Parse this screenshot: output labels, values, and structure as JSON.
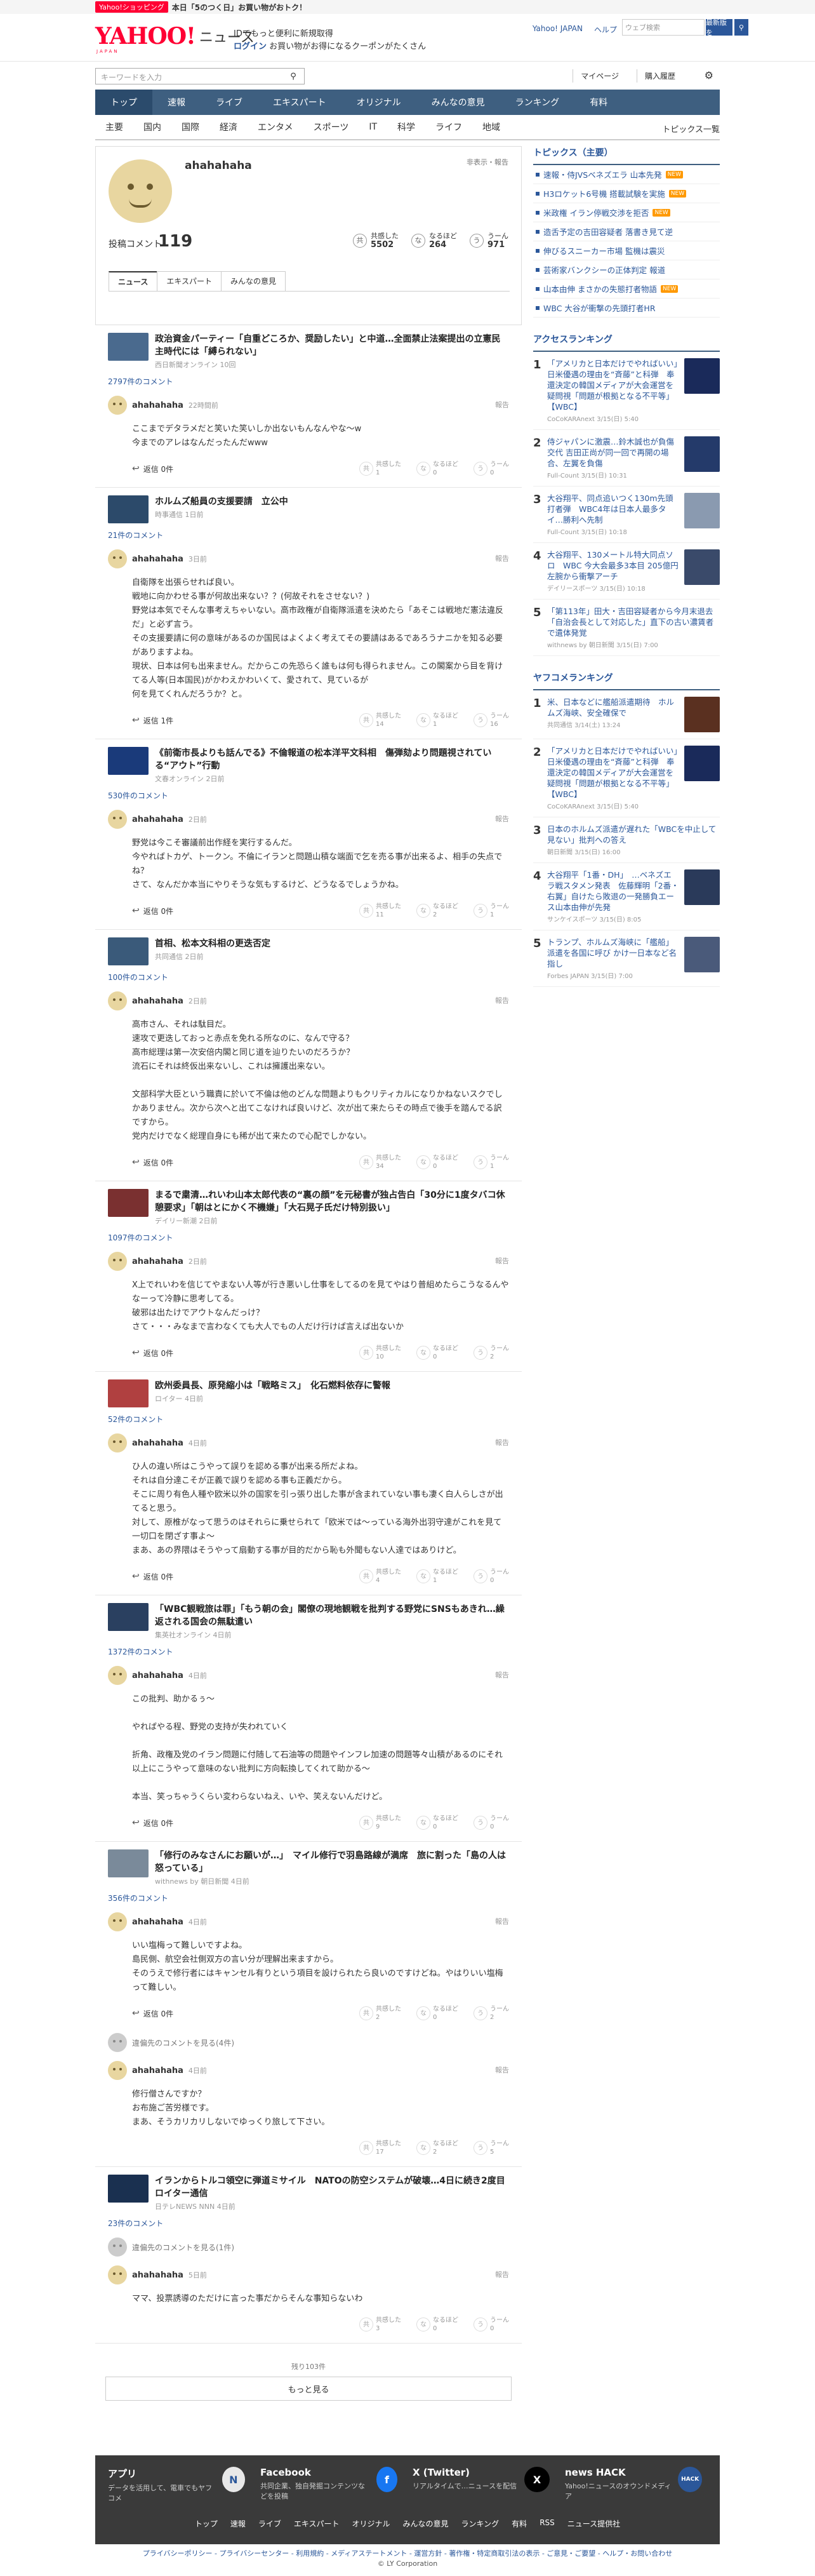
{
  "promo": {
    "badge": "Yahoo!ショッピング",
    "text": "本日「5のつく日」お買い物がおトク！"
  },
  "header": {
    "logo": "YAHOO!",
    "logo_sub": "JAPAN",
    "news_label": "ニュース",
    "msg_line1": "IDでもっと便利に新規取得",
    "msg_line2_prefix": "ログイン",
    "msg_line2": "お買い物がお得になるクーポンがたくさん",
    "links": [
      "Yahoo! JAPAN",
      "ヘルプ"
    ],
    "search_placeholder": "ウェブ検索",
    "search_btn": "最新版を",
    "search_btn2": "検索"
  },
  "search": {
    "placeholder": "キーワードを入力",
    "mypage": "マイページ",
    "history": "購入履歴"
  },
  "gnav": [
    "トップ",
    "速報",
    "ライブ",
    "エキスパート",
    "オリジナル",
    "みんなの意見",
    "ランキング",
    "有料"
  ],
  "cnav": [
    "主要",
    "国内",
    "国際",
    "経済",
    "エンタメ",
    "スポーツ",
    "IT",
    "科学",
    "ライフ",
    "地域"
  ],
  "cnav_all": "トピックス一覧",
  "profile": {
    "name": "ahahahaha",
    "report": "非表示・報告",
    "count_label": "投稿コメント",
    "count": "119",
    "stats": [
      {
        "icon": "共",
        "label": "共感した",
        "value": "5502"
      },
      {
        "icon": "な",
        "label": "なるほど",
        "value": "264"
      },
      {
        "icon": "う",
        "label": "うーん",
        "value": "971"
      }
    ],
    "tabs": [
      "ニュース",
      "エキスパート",
      "みんなの意見"
    ]
  },
  "entries": [
    {
      "title": "政治資金パーティー「自重どころか、奨励したい」と中道…全面禁止法案提出の立憲民主時代には「縛られない」",
      "src": "西日新聞オンライン 10回",
      "thumb": "#4a6a8e",
      "count": "2797件のコメント",
      "comments": [
        {
          "name": "ahahahaha",
          "date": "22時間前",
          "body": "ここまでデタラメだと笑いた笑いしか出ないもんなんやな〜w\n今までのアレはなんだったんだwww",
          "reply": "返信 0件",
          "v": [
            "1",
            "0",
            "0"
          ]
        }
      ]
    },
    {
      "title": "ホルムズ船員の支援要請　立公中",
      "src": "時事通信 1日前",
      "thumb": "#2c4a6a",
      "count": "21件のコメント",
      "comments": [
        {
          "name": "ahahahaha",
          "date": "3日前",
          "body": "自衛隊を出張らせれば良い。\n戦地に向かわせる事が何故出来ない？？(何故それをさせない？)\n野党は本気でそんな事考えちゃいない。高市政権が自衛隊派遣を決めたら「あそこは戦地だ憲法違反だ」と必ず言う。\nその支援要請に何の意味があるのか国民はよくよく考えてその要請はあるであろうナニかを知る必要がありますよね。\n現状、日本は何も出来ません。だからこの先恐らく誰もは何も得られません。この閣案から目を背けてる人等(日本国民)がかわえかわいくて、愛されて、見ているが\n何を見てくれんだろうか？と。",
          "reply": "返信 1件",
          "v": [
            "14",
            "1",
            "16"
          ]
        }
      ]
    },
    {
      "title": "《前衛市長よりも話んでる》不倫報道の松本洋平文科相　傷弾劾より問題視されている“アウト”行動",
      "src": "文春オンライン 2日前",
      "thumb": "#1a3a7a",
      "count": "530件のコメント",
      "comments": [
        {
          "name": "ahahahaha",
          "date": "2日前",
          "body": "野党は今こそ審議前出作経を実行するんだ。\n今やればトカゲ、トークン。不倫にイランと問題山積な端面で乞を売る事が出来るよ、相手の失点でね？\nさて、なんだか本当にやりそうな気もするけど、どうなるでしょうかね。",
          "reply": "返信 0件",
          "v": [
            "11",
            "2",
            "1"
          ]
        }
      ]
    },
    {
      "title": "首相、松本文科相の更迭否定",
      "src": "共同通信 2日前",
      "thumb": "#3a5a7a",
      "count": "100件のコメント",
      "comments": [
        {
          "name": "ahahahaha",
          "date": "2日前",
          "body": "高市さん、それは駄目だ。\n速攻で更迭しておっと赤点を免れる所なのに、なんで守る？\n高市総理は第一次安倍内閣と同じ道を辿りたいのだろうか？\n流石にそれは終仮出来ないし、これは擁護出来ない。\n\n文部科学大臣という職責に於いて不倫は他のどんな問題よりもクリティカルになりかねないスクでしかありません。次から次へと出てこなければ良いけど、次が出て来たらその時点で後手を踏んでる訳ですから。\n党内だけでなく総理自身にも稀が出て来たので心配でしかない。",
          "reply": "返信 0件",
          "v": [
            "34",
            "0",
            "1"
          ]
        }
      ]
    },
    {
      "title": "まるで粛清…れいわ山本太郎代表の“裏の顔”を元秘書が独占告白「30分に1度タバコ休憩要求」「朝はとにかく不機嫌」「大石晃子氏だけ特別扱い」",
      "src": "デイリー新潮 2日前",
      "thumb": "#7a3030",
      "count": "1097件のコメント",
      "comments": [
        {
          "name": "ahahahaha",
          "date": "2日前",
          "body": "X上でれいわを信じてやまない人等が行き悪いし仕事をしてるのを見てやはり普組めたらこうなるんやなーって冷静に思考してる。\n破邪は出たけでアウトなんだっけ？\nさて・・・みなまで言わなくても大人でもの人だけ行けば言えば出ないか",
          "reply": "返信 0件",
          "v": [
            "10",
            "0",
            "2"
          ]
        }
      ]
    },
    {
      "title": "欧州委員長、原発縮小は「戦略ミス」　化石燃料依存に警報",
      "src": "ロイター 4日前",
      "thumb": "#b04040",
      "count": "52件のコメント",
      "comments": [
        {
          "name": "ahahahaha",
          "date": "4日前",
          "body": "ひ人の違い所はこうやって誤りを認める事が出来る所だよね。\nそれは自分達こそが正義で誤りを認める事も正義だから。\nそこに周り有色人種や欧米以外の国家を引っ張り出した事が含まれていない事も凄く白人らしさが出てると思う。\n対して、原椎がなって思うのはそれらに乗せられて「欧米では〜っている海外出羽守達がこれを見て一切口を閉ざす事よ〜\nまあ、あの界隈はそうやって扇動する事が目的だから恥も外聞もない人達ではありけど。",
          "reply": "返信 0件",
          "v": [
            "4",
            "1",
            "0"
          ]
        }
      ]
    },
    {
      "title": "「WBC観戦旅は罪」「もう朝の会」閣僚の現地観戦を批判する野党にSNSもあきれ…繰返される国会の無駄遣い",
      "src": "集英社オンライン 4日前",
      "thumb": "#2a4060",
      "count": "1372件のコメント",
      "comments": [
        {
          "name": "ahahahaha",
          "date": "4日前",
          "body": "この批判、助かるぅ〜\n\nやればやる程、野党の支持が失われていく\n\n折角、政権及党のイラン問題に付随して石油等の問題やインフレ加速の問題等々山積があるのにそれ以上にこうやって意味のない批判に方向転換してくれて助かる〜\n\n本当、笑っちゃうくらい変わらないねえ、いや、笑えないんだけど。",
          "reply": "返信 0件",
          "v": [
            "9",
            "0",
            "0"
          ]
        }
      ]
    },
    {
      "title": "「修行のみなさんにお願いが…」　マイル修行で羽島路線が満席　旅に割った「島の人は怒っている」",
      "src": "withnews by 朝日新聞 4日前",
      "thumb": "#7a8a9a",
      "count": "356件のコメント",
      "comments": [
        {
          "name": "ahahahaha",
          "date": "4日前",
          "body": "いい塩梅って難しいですよね。\n島民側、航空会社側双方の言い分が理解出来ますから。\nそのうえで修行者にはキャンセル有りという項目を設けられたら良いのですけどね。やはりいい塩梅って難しい。",
          "reply": "返信 0件",
          "v": [
            "2",
            "0",
            "2"
          ]
        },
        {
          "deleted": true,
          "text": "違偏先のコメントを見る(4件)"
        },
        {
          "name": "ahahahaha",
          "date": "4日前",
          "body": "修行僧さんですか？\nお布施ご苦労様です。\nまあ、そうカリカリしないでゆっくり旅して下さい。",
          "reply": "",
          "v": [
            "17",
            "2",
            "5"
          ]
        }
      ]
    },
    {
      "title": "イランからトルコ領空に弾道ミサイル　NATOの防空システムが破壊…4日に続き2度目 ロイター通信",
      "src": "日テレNEWS NNN 4日前",
      "thumb": "#1a3050",
      "count": "23件のコメント",
      "comments": [
        {
          "deleted": true,
          "text": "違偏先のコメントを見る(1件)"
        },
        {
          "name": "ahahahaha",
          "date": "5日前",
          "body": "ママ、投票誘導のただけに言った事だからそんな事知らないわ",
          "reply": "",
          "v": [
            "3",
            "0",
            "0"
          ]
        }
      ]
    }
  ],
  "more": {
    "rest": "残り103件",
    "label": "もっと見る"
  },
  "topics": {
    "title": "トピックス（主要）",
    "items": [
      {
        "label": "速報・侍JVSベネズエラ 山本先発",
        "tag": "NEW",
        "tagcls": "new"
      },
      {
        "label": "H3ロケット6号機 搭載試験を実施",
        "tag": "NEW",
        "tagcls": "new"
      },
      {
        "label": "米政権 イラン停戦交渉を拒否",
        "tag": "NEW",
        "tagcls": "new"
      },
      {
        "label": "造舌予定の吉田容疑者 落書き見て逆",
        "tag": "",
        "tagcls": ""
      },
      {
        "label": "伸びるスニーカー市場 監機は震災",
        "tag": "",
        "tagcls": ""
      },
      {
        "label": "芸術家バンクシーの正体判定 報道",
        "tag": "",
        "tagcls": ""
      },
      {
        "label": "山本由伸 まさかの失態打者物語",
        "tag": "NEW",
        "tagcls": "new"
      },
      {
        "label": "WBC 大谷が衝撃の先頭打者HR",
        "tag": "",
        "tagcls": ""
      }
    ]
  },
  "access_rank": {
    "title": "アクセスランキング",
    "items": [
      {
        "no": "1",
        "title": "「アメリカと日本だけでやればいい」日米優遇の理由を“斉藤”と科弾　奉還決定の韓国メディアが大会運営を疑問視「問題が根拠となる不平等」【WBC】",
        "src": "CoCoKARAnext 3/15(日) 5:40",
        "thumb": "#1a2a5a"
      },
      {
        "no": "2",
        "title": "侍ジャパンに激震…鈴木誠也が負傷交代 吉田正尚が同一回で再開の場合、左翼を負傷",
        "src": "Full-Count 3/15(日) 10:31",
        "thumb": "#243a6a"
      },
      {
        "no": "3",
        "title": "大谷翔平、同点追いつく130m先頭打者弾　WBC4年は日本人最多タイ…勝利へ先制",
        "src": "Full-Count 3/15(日) 10:18",
        "thumb": "#8a9ab0"
      },
      {
        "no": "4",
        "title": "大谷翔平、130メートル特大同点ソロ　WBC 今大会最多3本目 205億円左腕から衝撃アーチ",
        "src": "デイリースポーツ 3/15(日) 10:18",
        "thumb": "#3a4a6a"
      },
      {
        "no": "5",
        "title": "「第113年」田大・吉田容疑者から今月末退去　「自治会長として対応した」直下の古い濃賃者で遺体発覚",
        "src": "withnews by 朝日新聞 3/15(日) 7:00",
        "thumb": ""
      }
    ]
  },
  "comment_rank": {
    "title": "ヤフコメランキング",
    "items": [
      {
        "no": "1",
        "title": "米、日本などに艦船派遣期待　ホルムズ海峡、安全確保で",
        "src": "共同通信 3/14(土) 13:24",
        "thumb": "#5a3020"
      },
      {
        "no": "2",
        "title": "「アメリカと日本だけでやればいい」日米優遇の理由を“斉藤”と科弾　奉還決定の韓国メディアが大会運営を疑問視「問題が根拠となる不平等」【WBC】",
        "src": "CoCoKARAnext 3/15(日) 5:40",
        "thumb": "#1a2a5a"
      },
      {
        "no": "3",
        "title": "日本のホルムズ派遣が遅れた「WBCを中止して見ない」批判への答え",
        "src": "朝日新聞 3/15(日) 16:00",
        "thumb": ""
      },
      {
        "no": "4",
        "title": "大谷翔平「1番・DH」　…ベネズエラ戦スタメン発表　佐藤輝明「2番・右翼」自けたら敗退の一発勝負エース山本由伸が先発",
        "src": "サンケイスポーツ 3/15(日) 8:05",
        "thumb": "#2a3a5a"
      },
      {
        "no": "5",
        "title": "トランプ、ホルムズ海峡に「艦船」派遣を各国に呼び かけ一日本など名指し",
        "src": "Forbes JAPAN 3/15(日) 7:00",
        "thumb": "#4a5a7a"
      }
    ]
  },
  "footer": {
    "apps": [
      {
        "title": "アプリ",
        "desc": "データを活用して、電車でもヤフコメ",
        "icon": "N",
        "color": "#e8e8e8",
        "fg": "#2b579a"
      },
      {
        "title": "Facebook",
        "desc": "共同企業、独自発掘コンテンツなどを投稿",
        "icon": "f",
        "color": "#1877f2",
        "fg": "#fff"
      },
      {
        "title": "X (Twitter)",
        "desc": "リアルタイムで…ニュースを配信",
        "icon": "X",
        "color": "#000",
        "fg": "#fff"
      },
      {
        "title": "news HACK",
        "desc": "Yahoo!ニュースのオウンドメディア",
        "icon": "HACK",
        "color": "#2b579a",
        "fg": "#fff"
      }
    ],
    "nav": [
      "トップ",
      "速報",
      "ライブ",
      "エキスパート",
      "オリジナル",
      "みんなの意見",
      "ランキング",
      "有料",
      "RSS",
      "ニュース提供社"
    ],
    "links": "プライバシーポリシー - プライバシーセンター - 利用規約 - メディアステートメント - 運営方針 - 著作権・特定商取引法の表示 - ご意見・ご要望 - ヘルプ・お問い合わせ",
    "copyright": "© LY Corporation"
  }
}
